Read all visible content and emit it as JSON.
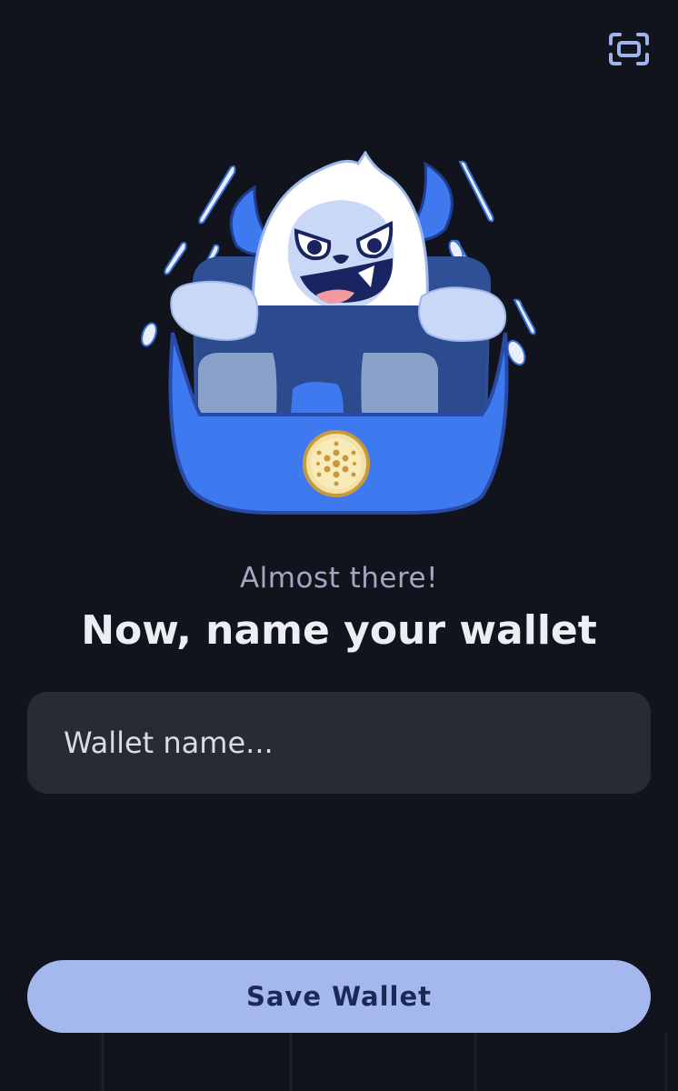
{
  "header": {
    "expand_icon": "fullscreen-frame-icon"
  },
  "illustration": {
    "icon": "yeti-mascot-in-wallet-with-ada-coin",
    "coin_icon": "cardano-coin-icon"
  },
  "content": {
    "subtitle": "Almost there!",
    "title": "Now, name your wallet"
  },
  "wallet_name_input": {
    "placeholder": "Wallet name...",
    "value": ""
  },
  "actions": {
    "save_label": "Save Wallet"
  },
  "colors": {
    "background": "#11141c",
    "input_background": "#272b35",
    "button_background": "#a5b8ee",
    "button_text": "#1a2a57",
    "accent_blue": "#3f79f0"
  }
}
